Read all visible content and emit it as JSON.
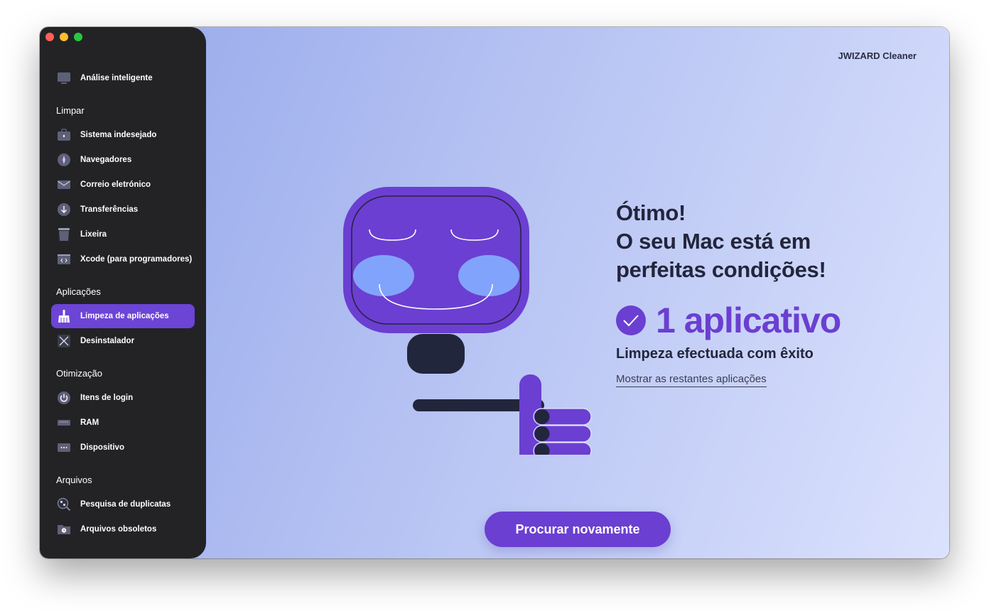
{
  "app": {
    "brand": "JWIZARD Cleaner"
  },
  "sidebar": {
    "top_item": {
      "label": "Análise inteligente",
      "icon": "monitor-icon"
    },
    "sections": [
      {
        "title": "Limpar",
        "items": [
          {
            "label": "Sistema indesejado",
            "icon": "briefcase-icon"
          },
          {
            "label": "Navegadores",
            "icon": "compass-icon"
          },
          {
            "label": "Correio eletrónico",
            "icon": "envelope-icon"
          },
          {
            "label": "Transferências",
            "icon": "download-icon"
          },
          {
            "label": "Lixeira",
            "icon": "trash-icon"
          },
          {
            "label": "Xcode (para programadores)",
            "icon": "code-icon"
          }
        ]
      },
      {
        "title": "Aplicações",
        "items": [
          {
            "label": "Limpeza de aplicações",
            "icon": "broom-icon",
            "active": true
          },
          {
            "label": "Desinstalador",
            "icon": "uninstall-icon"
          }
        ]
      },
      {
        "title": "Otimização",
        "items": [
          {
            "label": "Itens de login",
            "icon": "power-icon"
          },
          {
            "label": "RAM",
            "icon": "ram-icon"
          },
          {
            "label": "Dispositivo",
            "icon": "device-icon"
          }
        ]
      },
      {
        "title": "Arquivos",
        "items": [
          {
            "label": "Pesquisa de duplicatas",
            "icon": "duplicate-search-icon"
          },
          {
            "label": "Arquivos obsoletos",
            "icon": "old-folder-icon"
          }
        ]
      }
    ]
  },
  "main": {
    "headline": [
      "Ótimo!",
      "O seu Mac está em",
      "perfeitas condições!"
    ],
    "count_text": "1 aplicativo",
    "status": "Limpeza efectuada com êxito",
    "show_link": "Mostrar as restantes aplicações",
    "rescan_button": "Procurar novamente"
  },
  "colors": {
    "accent": "#6b3fd1",
    "sidebar_bg": "#232325",
    "text_dark": "#22253c"
  }
}
